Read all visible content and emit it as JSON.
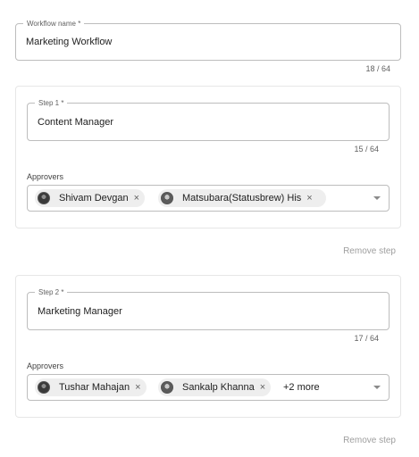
{
  "workflow": {
    "label": "Workflow name *",
    "value": "Marketing Workflow",
    "counter": "18 / 64"
  },
  "steps": [
    {
      "label": "Step 1 *",
      "value": "Content Manager",
      "counter": "15 / 64",
      "approvers_label": "Approvers",
      "approvers": [
        {
          "name": "Shivam Devgan",
          "remove": "×",
          "avatar_icon": "user-avatar-icon"
        },
        {
          "name": "Matsubara(Statusbrew) His",
          "remove": "×",
          "avatar_icon": "user-avatar-icon"
        }
      ],
      "more": "",
      "remove_label": "Remove step"
    },
    {
      "label": "Step 2 *",
      "value": "Marketing Manager",
      "counter": "17 / 64",
      "approvers_label": "Approvers",
      "approvers": [
        {
          "name": "Tushar Mahajan",
          "remove": "×",
          "avatar_icon": "user-avatar-icon"
        },
        {
          "name": "Sankalp Khanna",
          "remove": "×",
          "avatar_icon": "user-avatar-icon"
        }
      ],
      "more": "+2 more",
      "remove_label": "Remove step"
    }
  ],
  "colors": {
    "border": "#bdbdbd",
    "card_border": "#e6e6e6",
    "chip_bg": "#eeeeee",
    "muted_text": "#9e9e9e"
  }
}
